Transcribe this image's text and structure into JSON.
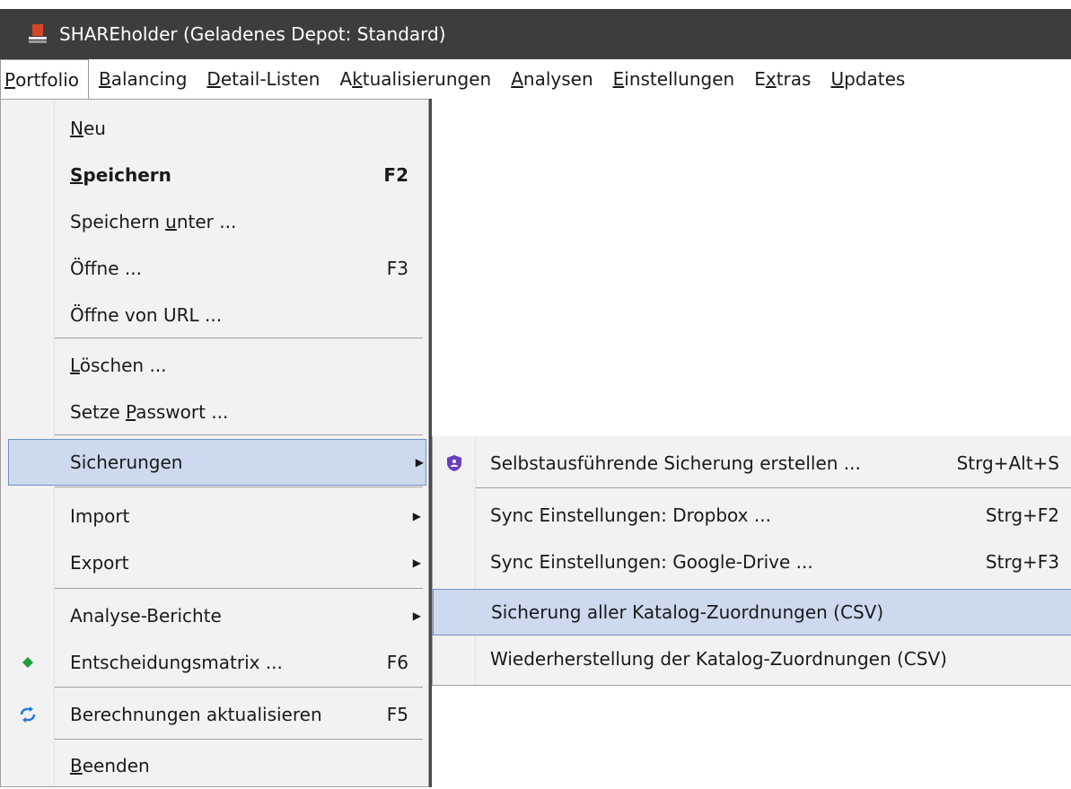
{
  "window": {
    "title": "SHAREholder (Geladenes Depot: Standard)"
  },
  "menubar": {
    "items": [
      {
        "label": "Portfolio"
      },
      {
        "label": "Balancing"
      },
      {
        "label": "Detail-Listen"
      },
      {
        "label": "Aktualisierungen"
      },
      {
        "label": "Analysen"
      },
      {
        "label": "Einstellungen"
      },
      {
        "label": "Extras"
      },
      {
        "label": "Updates"
      }
    ]
  },
  "portfolio_menu": {
    "neu": {
      "label": "Neu"
    },
    "speichern": {
      "label": "Speichern",
      "shortcut": "F2"
    },
    "speichern_unter": {
      "label": "Speichern unter ..."
    },
    "oeffne": {
      "label": "Öffne ...",
      "shortcut": "F3"
    },
    "oeffne_url": {
      "label": "Öffne von URL ..."
    },
    "loeschen": {
      "label": "Löschen ..."
    },
    "passwort": {
      "label": "Setze Passwort ..."
    },
    "sicherungen": {
      "label": "Sicherungen"
    },
    "import": {
      "label": "Import"
    },
    "export": {
      "label": "Export"
    },
    "analyse_berichte": {
      "label": "Analyse-Berichte"
    },
    "entscheidungsmatrix": {
      "label": "Entscheidungsmatrix ...",
      "shortcut": "F6",
      "icon": "green-diamond-icon"
    },
    "berechnungen": {
      "label": "Berechnungen aktualisieren",
      "shortcut": "F5",
      "icon": "refresh-arrows-icon"
    },
    "beenden": {
      "label": "Beenden"
    }
  },
  "sicherungen_submenu": {
    "selbstausfuehrend": {
      "label": "Selbstausführende Sicherung erstellen ...",
      "shortcut": "Strg+Alt+S",
      "icon": "shield-icon"
    },
    "sync_dropbox": {
      "label": "Sync Einstellungen: Dropbox  ...",
      "shortcut": "Strg+F2"
    },
    "sync_google": {
      "label": "Sync Einstellungen: Google-Drive ...",
      "shortcut": "Strg+F3"
    },
    "sicherung_katalog": {
      "label": "Sicherung aller Katalog-Zuordnungen (CSV)"
    },
    "wiederherstellung": {
      "label": "Wiederherstellung der Katalog-Zuordnungen (CSV)"
    }
  },
  "colors": {
    "highlight_bg": "#cdd9ee",
    "highlight_border": "#6f93c7",
    "titlebar_bg": "#3d3d3d",
    "menu_bg": "#f2f2f2",
    "shield": "#6b3fc0",
    "diamond": "#1e9e3c",
    "refresh": "#1e7bd8"
  }
}
